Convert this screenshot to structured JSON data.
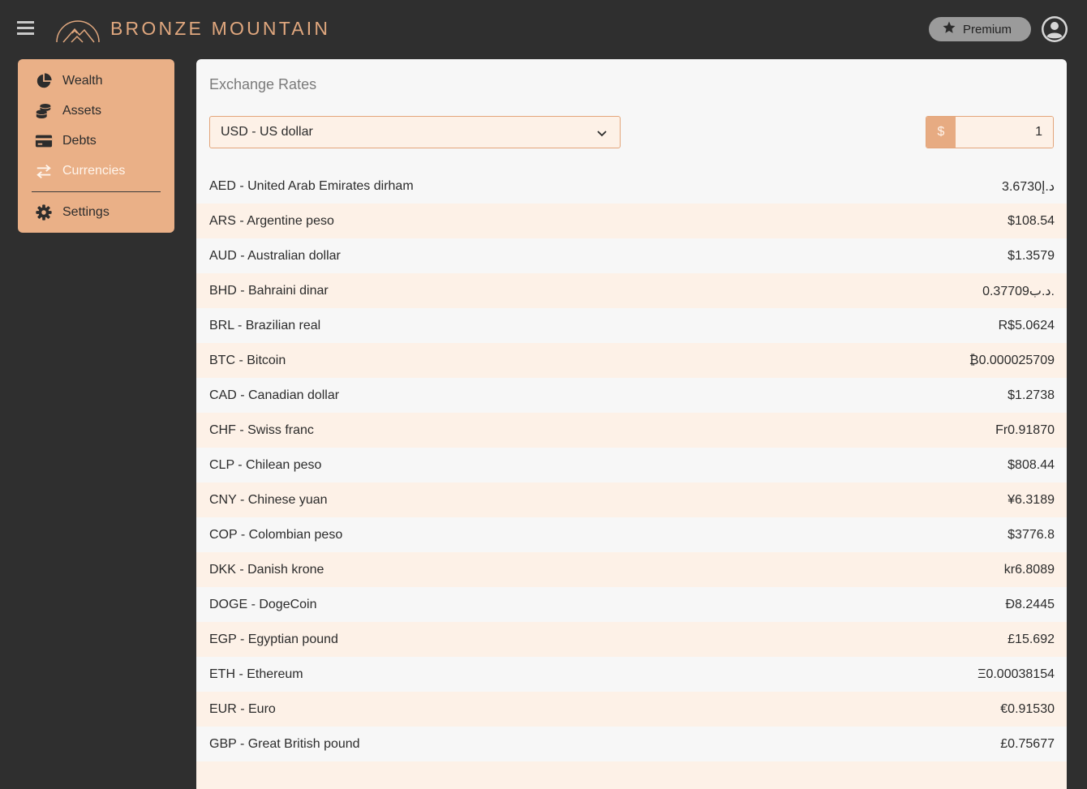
{
  "header": {
    "brand": "BRONZE MOUNTAIN",
    "premium_label": "Premium"
  },
  "sidebar": {
    "items": [
      {
        "label": "Wealth",
        "icon": "pie-chart-icon"
      },
      {
        "label": "Assets",
        "icon": "coins-icon"
      },
      {
        "label": "Debts",
        "icon": "credit-card-icon"
      },
      {
        "label": "Currencies",
        "icon": "exchange-arrows-icon",
        "active": true
      },
      {
        "label": "Settings",
        "icon": "gear-icon"
      }
    ]
  },
  "main": {
    "title": "Exchange Rates",
    "base_currency": "USD - US dollar",
    "amount_prefix": "$",
    "amount": "1",
    "rates": [
      {
        "currency": "AED - United Arab Emirates dirham",
        "value": "د.إ3.6730"
      },
      {
        "currency": "ARS - Argentine peso",
        "value": "$108.54"
      },
      {
        "currency": "AUD - Australian dollar",
        "value": "$1.3579"
      },
      {
        "currency": "BHD - Bahraini dinar",
        "value": ".د.ب0.37709"
      },
      {
        "currency": "BRL - Brazilian real",
        "value": "R$5.0624"
      },
      {
        "currency": "BTC - Bitcoin",
        "value": "₿0.000025709"
      },
      {
        "currency": "CAD - Canadian dollar",
        "value": "$1.2738"
      },
      {
        "currency": "CHF - Swiss franc",
        "value": "Fr0.91870"
      },
      {
        "currency": "CLP - Chilean peso",
        "value": "$808.44"
      },
      {
        "currency": "CNY - Chinese yuan",
        "value": "¥6.3189"
      },
      {
        "currency": "COP - Colombian peso",
        "value": "$3776.8"
      },
      {
        "currency": "DKK - Danish krone",
        "value": "kr6.8089"
      },
      {
        "currency": "DOGE - DogeCoin",
        "value": "Đ8.2445"
      },
      {
        "currency": "EGP - Egyptian pound",
        "value": "£15.692"
      },
      {
        "currency": "ETH - Ethereum",
        "value": "Ξ0.00038154"
      },
      {
        "currency": "EUR - Euro",
        "value": "€0.91530"
      },
      {
        "currency": "GBP - Great British pound",
        "value": "£0.75677"
      }
    ]
  },
  "colors": {
    "background": "#2f2f2f",
    "accent": "#eab087",
    "brand_text": "#e0a77e",
    "row_alt": "#fdf1e7"
  }
}
